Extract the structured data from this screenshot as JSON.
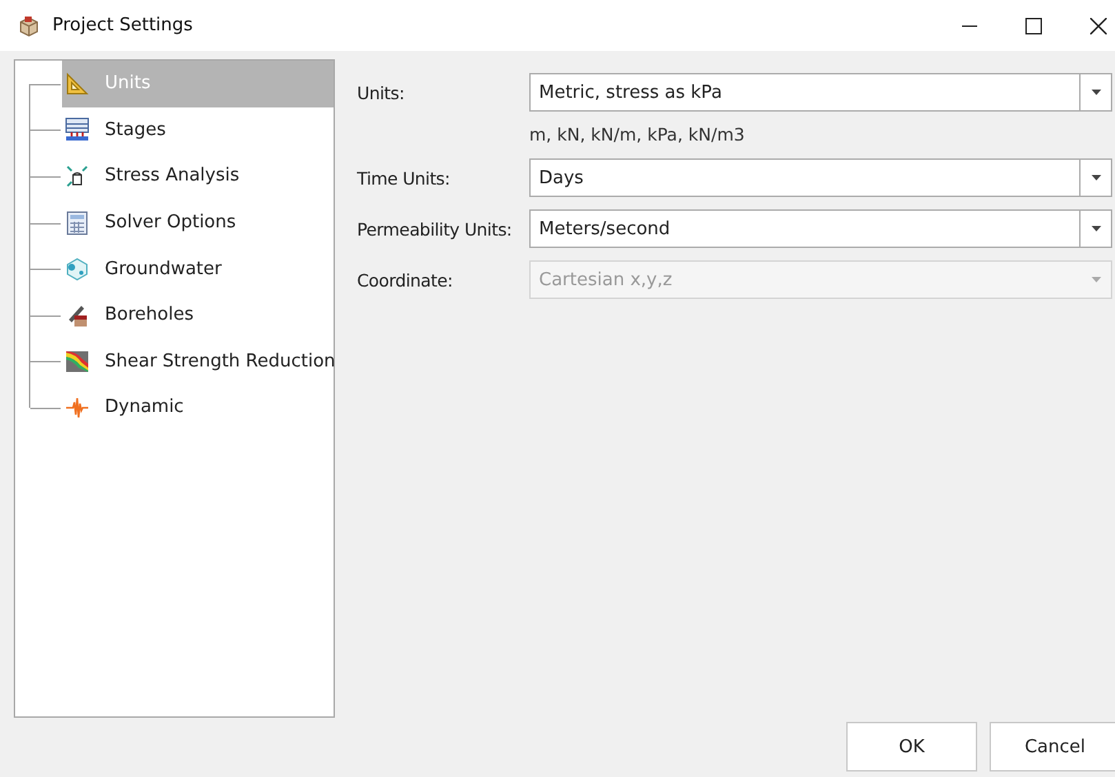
{
  "window": {
    "title": "Project Settings"
  },
  "tree": {
    "items": [
      {
        "label": "Units",
        "selected": true
      },
      {
        "label": "Stages",
        "selected": false
      },
      {
        "label": "Stress Analysis",
        "selected": false
      },
      {
        "label": "Solver Options",
        "selected": false
      },
      {
        "label": "Groundwater",
        "selected": false
      },
      {
        "label": "Boreholes",
        "selected": false
      },
      {
        "label": "Shear Strength Reduction",
        "selected": false
      },
      {
        "label": "Dynamic",
        "selected": false
      }
    ]
  },
  "form": {
    "rows": [
      {
        "kind": "dropdown",
        "label": "Units:",
        "value": "Metric, stress as kPa",
        "disabled": false
      },
      {
        "kind": "note",
        "text": "m, kN, kN/m, kPa, kN/m3"
      },
      {
        "kind": "dropdown",
        "label": "Time Units:",
        "value": "Days",
        "disabled": false
      },
      {
        "kind": "dropdown",
        "label": "Permeability Units:",
        "value": "Meters/second",
        "disabled": false
      },
      {
        "kind": "dropdown",
        "label": "Coordinate:",
        "value": "Cartesian x,y,z",
        "disabled": true
      }
    ]
  },
  "buttons": [
    "OK",
    "Cancel"
  ]
}
